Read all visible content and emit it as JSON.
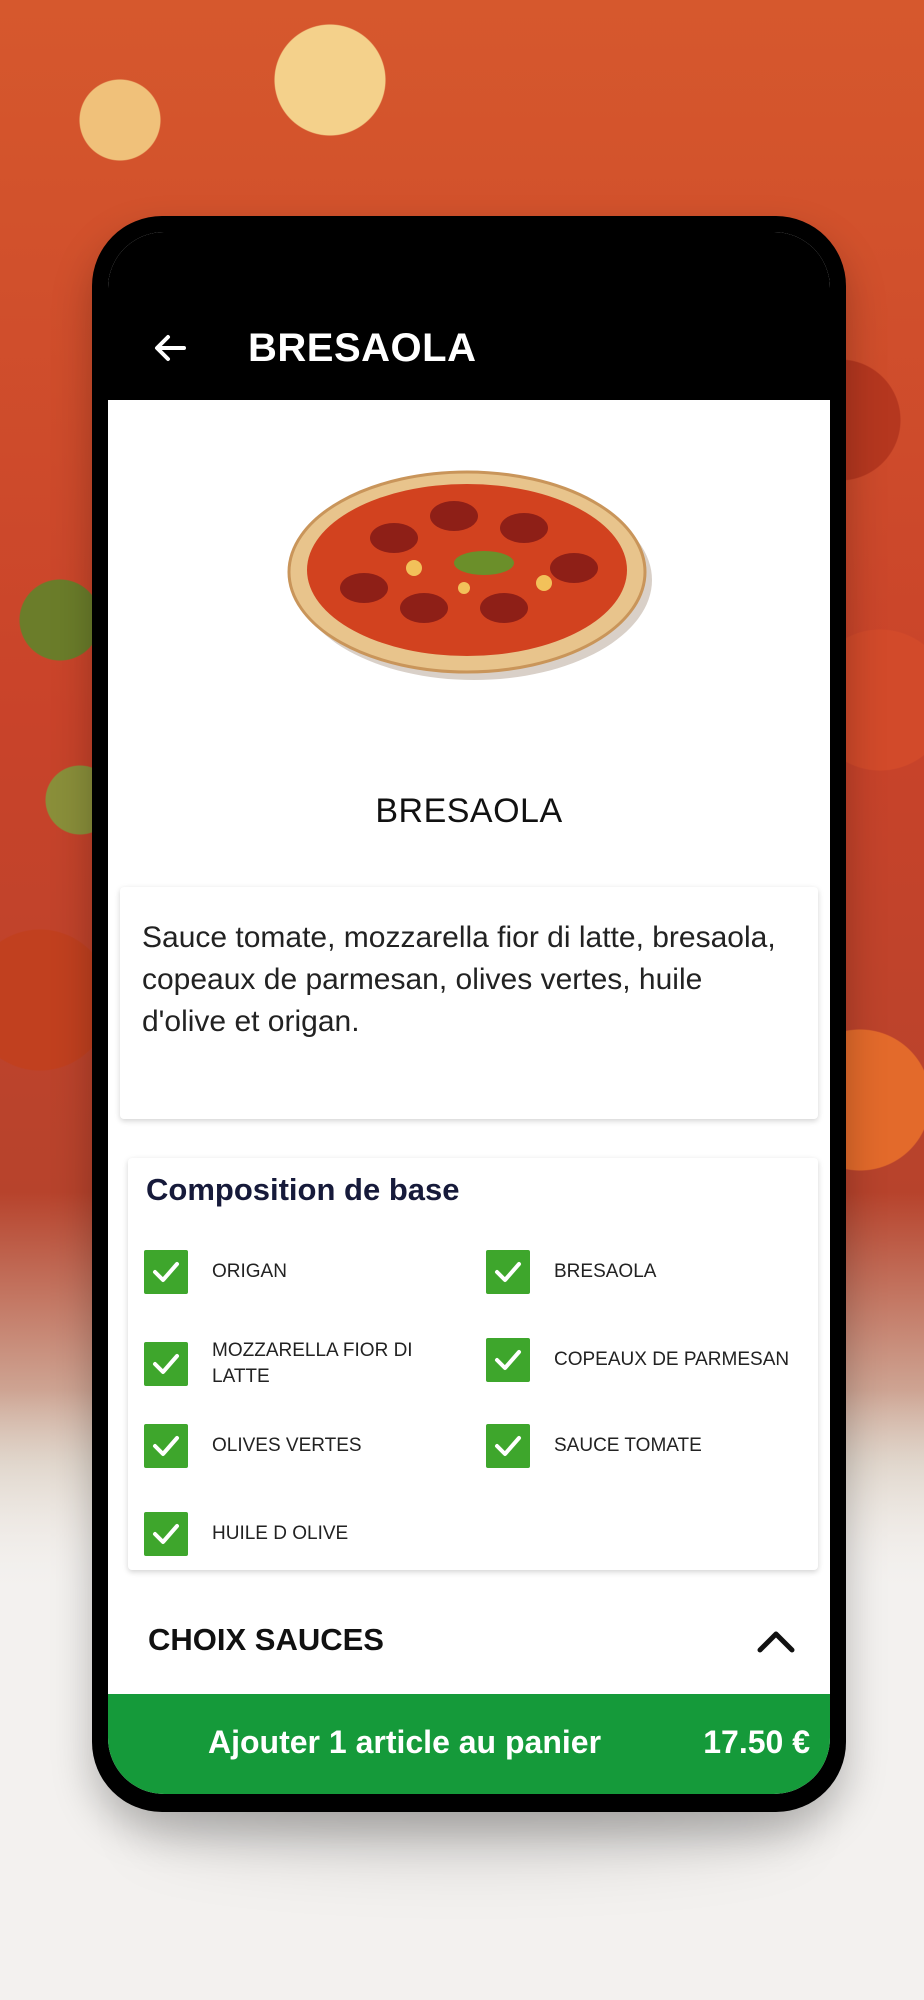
{
  "header": {
    "title": "BRESAOLA",
    "back_icon": "arrow-left-icon"
  },
  "product": {
    "name": "BRESAOLA",
    "image": "pizza-image",
    "description": "Sauce tomate, mozzarella fior di latte, bresaola, copeaux de parmesan, olives vertes, huile d'olive et origan."
  },
  "composition": {
    "title": "Composition de base",
    "items": [
      {
        "label": "ORIGAN",
        "checked": true
      },
      {
        "label": "BRESAOLA",
        "checked": true
      },
      {
        "label": "MOZZARELLA FIOR DI LATTE",
        "checked": true
      },
      {
        "label": "COPEAUX DE PARMESAN",
        "checked": true
      },
      {
        "label": "OLIVES VERTES",
        "checked": true
      },
      {
        "label": "SAUCE TOMATE",
        "checked": true
      },
      {
        "label": "HUILE D OLIVE",
        "checked": true
      }
    ]
  },
  "sauces": {
    "label": "CHOIX SAUCES",
    "icon": "chevron-up-icon"
  },
  "cart_button": {
    "label": "Ajouter 1 article au panier",
    "price": "17.50 €"
  },
  "colors": {
    "accent_green": "#159a3a",
    "checkbox_green": "#3ea62c",
    "appbar": "#000000"
  }
}
